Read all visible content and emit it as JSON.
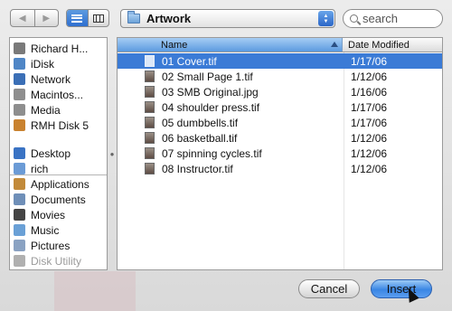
{
  "toolbar": {
    "back_symbol": "◀",
    "forward_symbol": "▶",
    "path_label": "Artwork",
    "search_placeholder": "search"
  },
  "sidebar": {
    "devices": [
      {
        "label": "Richard H...",
        "icon": "computer-icon",
        "color": "#7a7a7a"
      },
      {
        "label": "iDisk",
        "icon": "idisk-icon",
        "color": "#4f86c6"
      },
      {
        "label": "Network",
        "icon": "network-globe-icon",
        "color": "#3b6fb6"
      },
      {
        "label": "Macintos...",
        "icon": "hard-drive-icon",
        "color": "#8e8e8e"
      },
      {
        "label": "Media",
        "icon": "hard-drive-icon",
        "color": "#8e8e8e"
      },
      {
        "label": "RMH Disk 5",
        "icon": "external-drive-icon",
        "color": "#c9822f"
      }
    ],
    "places": [
      {
        "label": "Desktop",
        "icon": "desktop-icon",
        "color": "#3a73c4"
      },
      {
        "label": "rich",
        "icon": "home-icon",
        "color": "#6b9bd6"
      },
      {
        "label": "Applications",
        "icon": "applications-icon",
        "color": "#c28a3a"
      },
      {
        "label": "Documents",
        "icon": "documents-icon",
        "color": "#6f8fb8"
      },
      {
        "label": "Movies",
        "icon": "movies-icon",
        "color": "#444444"
      },
      {
        "label": "Music",
        "icon": "music-icon",
        "color": "#6aa0d6"
      },
      {
        "label": "Pictures",
        "icon": "pictures-icon",
        "color": "#8aa2c2"
      },
      {
        "label": "Disk Utility",
        "icon": "disk-utility-icon",
        "color": "#b0b0b0",
        "dim": true
      }
    ]
  },
  "filelist": {
    "columns": {
      "name": "Name",
      "date": "Date Modified"
    },
    "rows": [
      {
        "name": "01 Cover.tif",
        "date": "1/17/06",
        "selected": true,
        "icon": "tif-file-icon"
      },
      {
        "name": "02 Small Page 1.tif",
        "date": "1/12/06",
        "selected": false,
        "icon": "tif-file-icon"
      },
      {
        "name": "03 SMB Original.jpg",
        "date": "1/16/06",
        "selected": false,
        "icon": "jpg-file-icon"
      },
      {
        "name": "04 shoulder press.tif",
        "date": "1/17/06",
        "selected": false,
        "icon": "tif-file-icon"
      },
      {
        "name": "05 dumbbells.tif",
        "date": "1/17/06",
        "selected": false,
        "icon": "tif-file-icon"
      },
      {
        "name": "06 basketball.tif",
        "date": "1/12/06",
        "selected": false,
        "icon": "tif-file-icon"
      },
      {
        "name": "07 spinning cycles.tif",
        "date": "1/12/06",
        "selected": false,
        "icon": "tif-file-icon"
      },
      {
        "name": "08 Instructor.tif",
        "date": "1/12/06",
        "selected": false,
        "icon": "tif-file-icon"
      }
    ]
  },
  "buttons": {
    "cancel": "Cancel",
    "insert": "Insert"
  },
  "colors": {
    "selection": "#3b7bd6",
    "default_button": "#3a86e4"
  }
}
